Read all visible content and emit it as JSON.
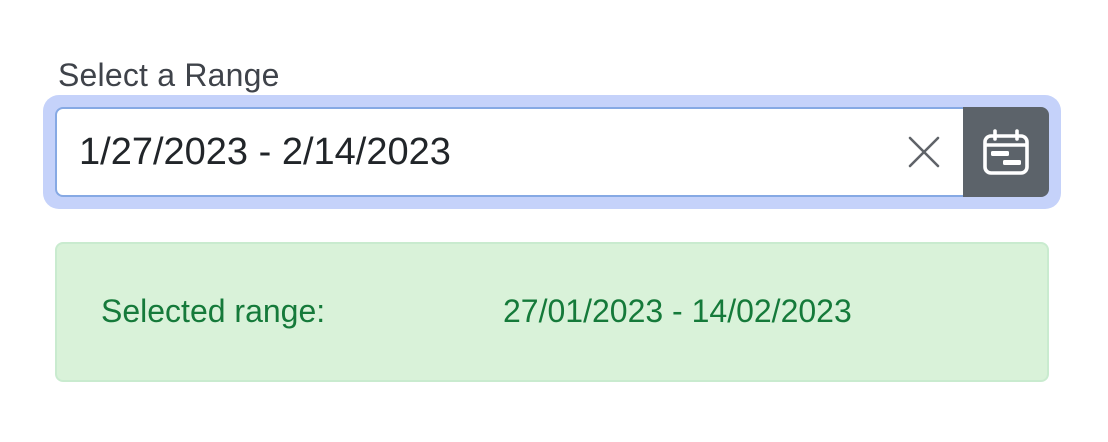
{
  "form": {
    "label": "Select a Range",
    "range_value": "1/27/2023 - 2/14/2023",
    "clear_icon": "close-icon",
    "calendar_icon": "calendar-icon"
  },
  "alert": {
    "label": "Selected range:",
    "value": "27/01/2023 - 14/02/2023"
  },
  "colors": {
    "focus_ring": "#c5d2fa",
    "input_border": "#86a9e4",
    "button_bg": "#5c636a",
    "alert_bg": "#d9f2d9",
    "alert_text": "#157a3a"
  }
}
